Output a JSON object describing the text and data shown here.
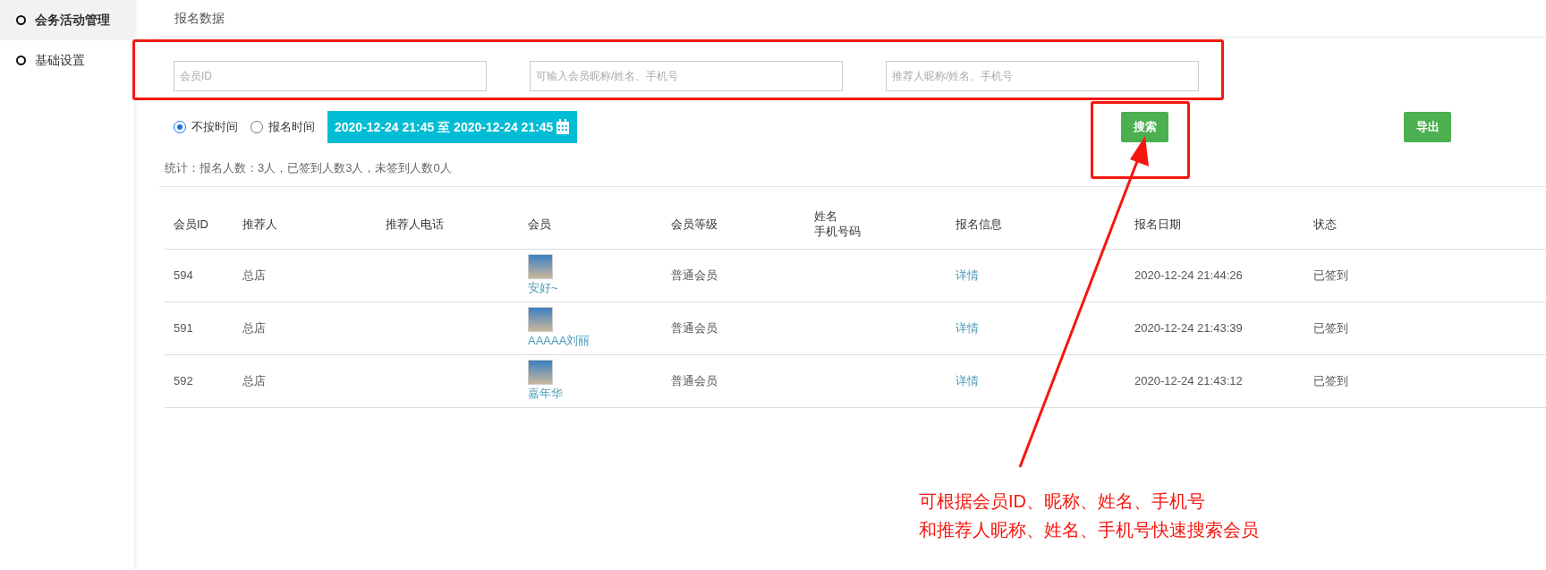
{
  "sidebar": {
    "items": [
      {
        "label": "会务活动管理",
        "selected": true
      },
      {
        "label": "基础设置",
        "selected": false
      }
    ]
  },
  "page_title": "报名数据",
  "filters": {
    "fields": [
      {
        "placeholder": "会员ID"
      },
      {
        "placeholder": "可输入会员昵称/姓名、手机号"
      },
      {
        "placeholder": "推荐人昵称/姓名、手机号"
      }
    ],
    "time_options": [
      {
        "label": "不按时间",
        "selected": true
      },
      {
        "label": "报名时间",
        "selected": false
      }
    ],
    "date_range": "2020-12-24 21:45 至 2020-12-24 21:45",
    "search_button": "搜索",
    "export_button": "导出"
  },
  "stats": "统计：报名人数：3人，已签到人数3人，未签到人数0人",
  "table": {
    "columns": [
      [
        "会员ID"
      ],
      [
        "推荐人"
      ],
      [
        "推荐人电话"
      ],
      [
        "会员"
      ],
      [
        "会员等级"
      ],
      [
        "姓名",
        "手机号码"
      ],
      [
        "报名信息"
      ],
      [
        "报名日期"
      ],
      [
        "状态"
      ]
    ],
    "rows": [
      {
        "member_id": "594",
        "referrer": "总店",
        "member": "安好~",
        "level": "普通会员",
        "info": "详情",
        "date": "2020-12-24 21:44:26",
        "status": "已签到"
      },
      {
        "member_id": "591",
        "referrer": "总店",
        "member": "AAAAA刘丽",
        "level": "普通会员",
        "info": "详情",
        "date": "2020-12-24 21:43:39",
        "status": "已签到"
      },
      {
        "member_id": "592",
        "referrer": "总店",
        "member": "嘉年华",
        "level": "普通会员",
        "info": "详情",
        "date": "2020-12-24 21:43:12",
        "status": "已签到"
      }
    ]
  },
  "annotation": {
    "lines": [
      "可根据会员ID、昵称、姓名、手机号",
      "和推荐人昵称、姓名、手机号快速搜索会员"
    ]
  }
}
